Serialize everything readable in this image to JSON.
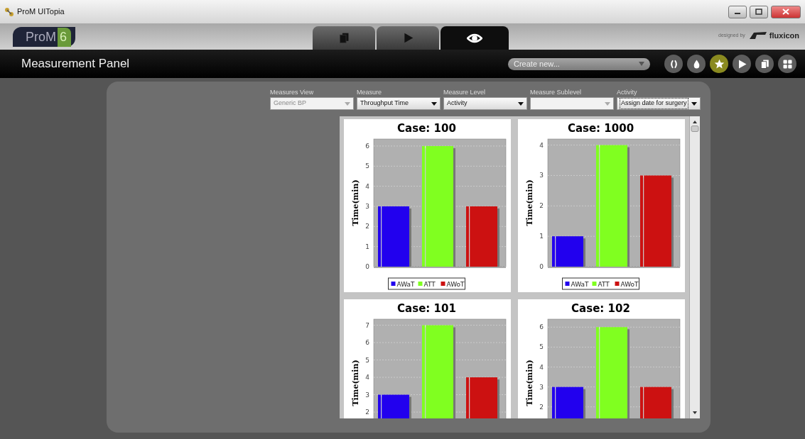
{
  "window": {
    "title": "ProM UITopia"
  },
  "header": {
    "logo": {
      "name": "ProM",
      "version": "6"
    },
    "tabs": [
      {
        "kind": "pages",
        "selected": false
      },
      {
        "kind": "play",
        "selected": false
      },
      {
        "kind": "eye",
        "selected": true
      }
    ],
    "credit": {
      "prefix": "designed by",
      "brand": "fluxicon"
    }
  },
  "toolbar": {
    "title": "Measurement Panel",
    "create_menu": {
      "value": "Create new..."
    },
    "icons": [
      {
        "kind": "parens",
        "selected": false
      },
      {
        "kind": "drop",
        "selected": false
      },
      {
        "kind": "star",
        "selected": true
      },
      {
        "kind": "play",
        "selected": false
      },
      {
        "kind": "pages",
        "selected": false
      },
      {
        "kind": "grid",
        "selected": false
      }
    ]
  },
  "filters": [
    {
      "label": "Measures View",
      "value": "Generic BP",
      "disabled": true,
      "focused": false
    },
    {
      "label": "Measure",
      "value": "Throughput Time",
      "disabled": false,
      "focused": false
    },
    {
      "label": "Measure Level",
      "value": "Activity",
      "disabled": false,
      "focused": false
    },
    {
      "label": "Measure Sublevel",
      "disabled": true,
      "focused": false
    },
    {
      "label": "Activity",
      "value": "Assign date for surgery",
      "disabled": false,
      "focused": true
    }
  ],
  "charts": [
    {
      "chart_data": {
        "type": "bar",
        "title": "Case: 100",
        "ylabel": "Time(min)",
        "grid": true,
        "legend": true,
        "ylim": [
          0,
          6.35
        ],
        "yticks": [
          0,
          1,
          2,
          3,
          4,
          5,
          6
        ],
        "series": [
          {
            "name": "AWaT",
            "color": "#2200ee",
            "values": [
              3
            ]
          },
          {
            "name": "ATT",
            "color": "#80ff20",
            "values": [
              6
            ]
          },
          {
            "name": "AWoT",
            "color": "#cc1111",
            "values": [
              3
            ]
          }
        ]
      }
    },
    {
      "chart_data": {
        "type": "bar",
        "title": "Case: 1000",
        "ylabel": "Time(min)",
        "grid": true,
        "legend": true,
        "ylim": [
          0,
          4.2
        ],
        "yticks": [
          0,
          1,
          2,
          3,
          4
        ],
        "series": [
          {
            "name": "AWaT",
            "color": "#2200ee",
            "values": [
              1
            ]
          },
          {
            "name": "ATT",
            "color": "#80ff20",
            "values": [
              4
            ]
          },
          {
            "name": "AWoT",
            "color": "#cc1111",
            "values": [
              3
            ]
          }
        ]
      }
    },
    {
      "chart_data": {
        "type": "bar",
        "title": "Case: 101",
        "ylabel": "Time(min)",
        "grid": true,
        "ylim": [
          0,
          7.35
        ],
        "yticks": [
          2,
          3,
          4,
          5,
          6,
          7
        ],
        "series": [
          {
            "color": "#2200ee",
            "values": [
              3
            ]
          },
          {
            "color": "#80ff20",
            "values": [
              7
            ]
          },
          {
            "color": "#cc1111",
            "values": [
              4
            ]
          }
        ]
      }
    },
    {
      "chart_data": {
        "type": "bar",
        "title": "Case: 102",
        "ylabel": "Time(min)",
        "grid": true,
        "ylim": [
          0,
          6.4
        ],
        "yticks": [
          2,
          3,
          4,
          5,
          6
        ],
        "series": [
          {
            "color": "#2200ee",
            "values": [
              3
            ]
          },
          {
            "color": "#80ff20",
            "values": [
              6
            ]
          },
          {
            "color": "#cc1111",
            "values": [
              3
            ]
          }
        ]
      }
    }
  ]
}
